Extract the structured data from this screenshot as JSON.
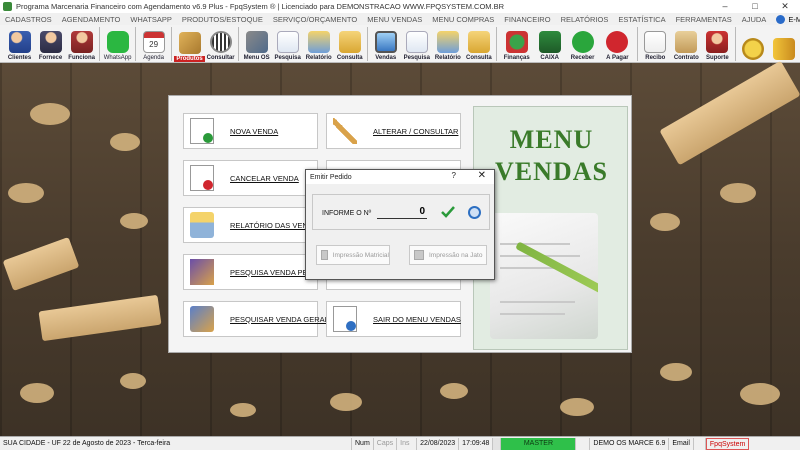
{
  "window": {
    "title": "Programa Marcenaria Financeiro com Agendamento v6.9 Plus - FpqSystem ® | Licenciado para  DEMONSTRACAO WWW.FPQSYSTEM.COM.BR",
    "controls": [
      "–",
      "□",
      "✕"
    ]
  },
  "menu": {
    "items": [
      "CADASTROS",
      "AGENDAMENTO",
      "WHATSAPP",
      "PRODUTOS/ESTOQUE",
      "SERVIÇO/ORÇAMENTO",
      "MENU VENDAS",
      "MENU COMPRAS",
      "FINANCEIRO",
      "RELATÓRIOS",
      "ESTATÍSTICA",
      "FERRAMENTAS",
      "AJUDA"
    ],
    "email": "E-MAIL"
  },
  "toolbar": {
    "clientes": "Clientes",
    "fornece": "Fornece",
    "funciona": "Funciona",
    "whatsapp": "WhatsApp",
    "agenda": "Agenda",
    "produtos": "Produtos",
    "consultar": "Consultar",
    "menu_os": "Menu OS",
    "pesquisa1": "Pesquisa",
    "relatorio1": "Relatório",
    "consulta1": "Consulta",
    "vendas": "Vendas",
    "pesquisa2": "Pesquisa",
    "relatorio2": "Relatório",
    "consulta2": "Consulta",
    "financas": "Finanças",
    "caixa": "CAIXA",
    "receber": "Receber",
    "a_pagar": "A Pagar",
    "recibo": "Recibo",
    "contrato": "Contrato",
    "suporte": "Suporte",
    "agenda_date": "29"
  },
  "panel": {
    "nova_venda": "NOVA VENDA",
    "alterar_consultar": "ALTERAR / CONSULTAR",
    "cancelar_venda": "CANCELAR VENDA",
    "relatorio_vendas": "RELATÓRIO DAS VENDAS",
    "pesquisa_pendente": "PESQUISA VENDA PENDENTE",
    "pesquisar_geral": "PESQUISAR VENDA GERAL",
    "sair_menu": "SAIR DO MENU VENDAS"
  },
  "banner": {
    "line1": "MENU",
    "line2": "VENDAS"
  },
  "dialog": {
    "title": "Emitir Pedido",
    "help": "?",
    "close": "✕",
    "label": "INFORME O Nº",
    "value": "0",
    "btn_matricial": "Impressão Matricial",
    "btn_jato": "Impressão na Jato"
  },
  "statusbar": {
    "city": "SUA CIDADE - UF 22 de Agosto de 2023 - Terca-feira",
    "num": "Num",
    "caps": "Caps",
    "ins": "Ins",
    "date": "22/08/2023",
    "time": "17:09:48",
    "master": "MASTER",
    "demo": "DEMO OS MARCE 6.9",
    "email": "Email",
    "fpq": "FpqSystem"
  },
  "colors": {
    "banner_text": "#3a7b2a",
    "master_bg": "#2fc04a",
    "brand_red": "#cc0000"
  }
}
